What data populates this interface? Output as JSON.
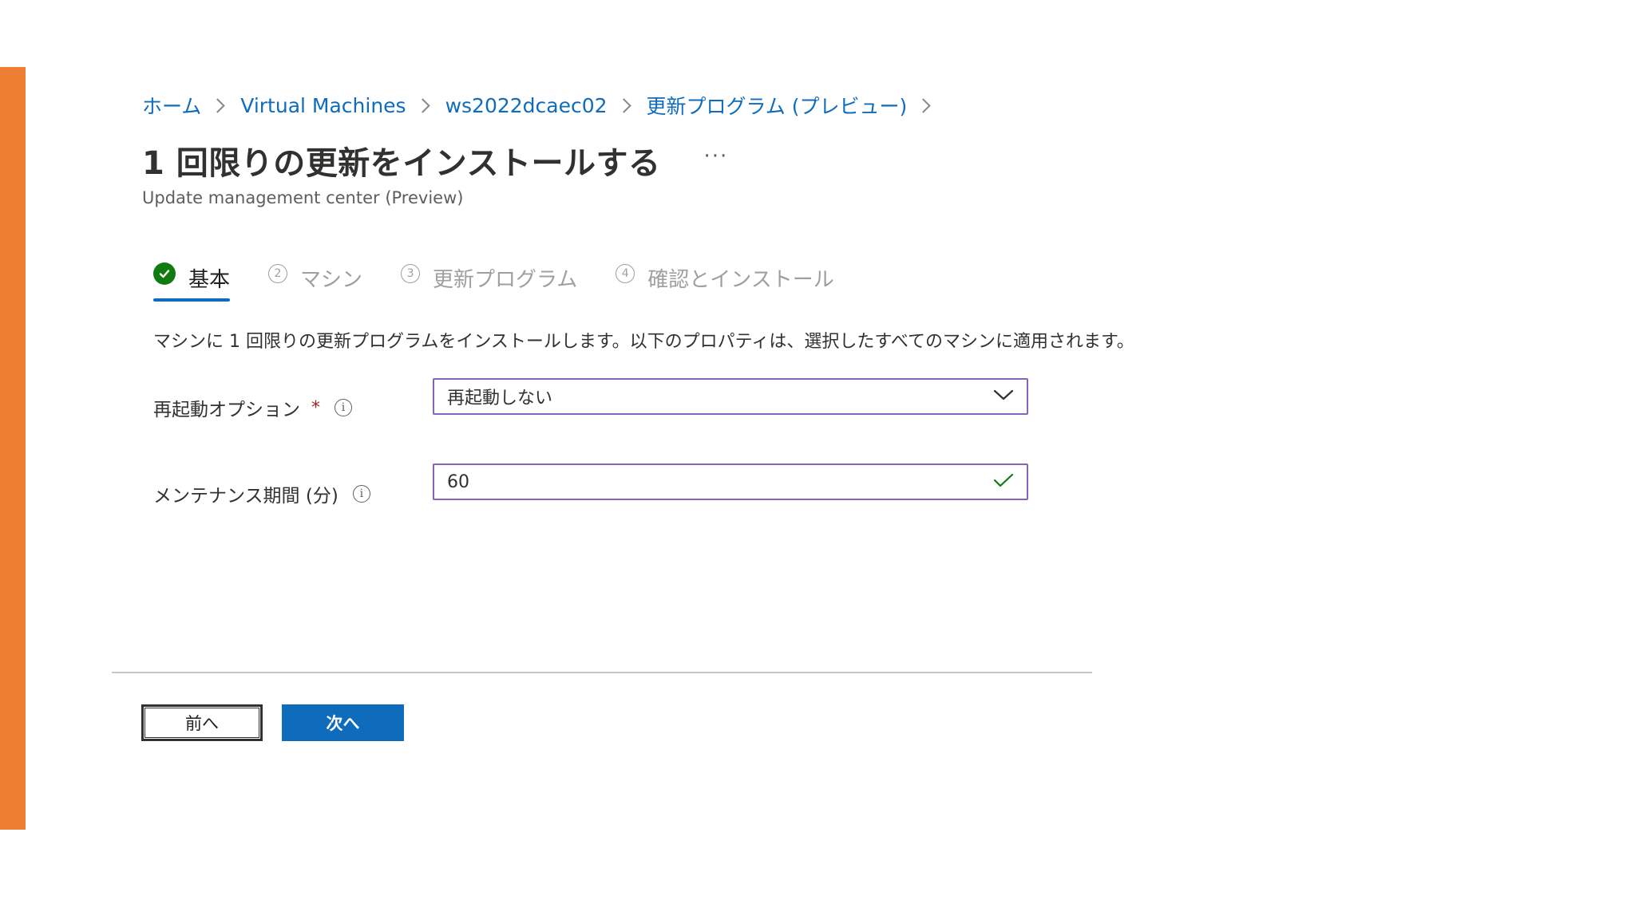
{
  "breadcrumb": {
    "items": [
      "ホーム",
      "Virtual Machines",
      "ws2022dcaec02",
      "更新プログラム (プレビュー)"
    ]
  },
  "header": {
    "title": "1 回限りの更新をインストールする",
    "more_label": "···",
    "subtitle": "Update management center (Preview)"
  },
  "wizard": {
    "tabs": [
      {
        "step": "",
        "label": "基本",
        "state": "completed"
      },
      {
        "step": "2",
        "label": "マシン",
        "state": "pending"
      },
      {
        "step": "3",
        "label": "更新プログラム",
        "state": "pending"
      },
      {
        "step": "4",
        "label": "確認とインストール",
        "state": "pending"
      }
    ]
  },
  "description": "マシンに 1 回限りの更新プログラムをインストールします。以下のプロパティは、選択したすべてのマシンに適用されます。",
  "form": {
    "reboot": {
      "label": "再起動オプション",
      "required_mark": "*",
      "info": "i",
      "value": "再起動しない"
    },
    "maintenance": {
      "label": "メンテナンス期間 (分)",
      "info": "i",
      "value": "60"
    }
  },
  "footer": {
    "prev_label": "前へ",
    "next_label": "次へ"
  },
  "colors": {
    "accent_bar": "#ed7d31",
    "link": "#0f6cbd",
    "primary_button": "#0f6cbd",
    "field_border": "#8764b8",
    "success": "#107c10",
    "required": "#a4262c"
  },
  "icons": {
    "completed_step": "checkmark-circle-icon",
    "dropdown": "chevron-down-icon",
    "valid": "checkmark-icon",
    "info": "info-icon",
    "separator": "chevron-right-icon"
  }
}
